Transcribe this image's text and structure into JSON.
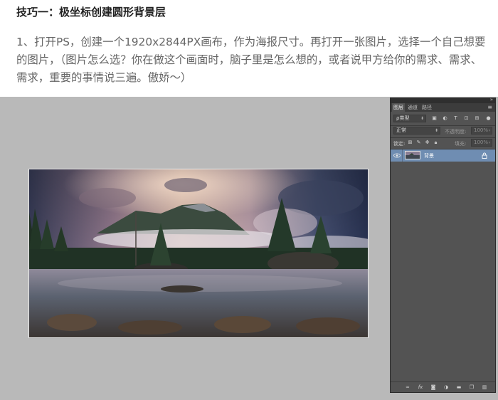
{
  "article": {
    "title": "技巧一：极坐标创建圆形背景层",
    "paragraph": "1、打开PS，创建一个1920x2844PX画布，作为海报尺寸。再打开一张图片，选择一个自己想要的图片，（图片怎么选？你在做这个画面时，脑子里是怎么想的，或者说甲方给你的需求、需求、需求，重要的事情说三遍。傲娇～）"
  },
  "layers_panel": {
    "collapse": "»",
    "tabs": [
      {
        "label": "图层",
        "active": true
      },
      {
        "label": "通道",
        "active": false
      },
      {
        "label": "路径",
        "active": false
      }
    ],
    "menu_icon": "≡",
    "filter": {
      "label": "ρ类型",
      "icons": [
        "image-filter-icon",
        "adjustment-filter-icon",
        "type-filter-icon",
        "shape-filter-icon",
        "smart-object-filter-icon",
        "toggle-filter-icon"
      ]
    },
    "blend_mode": "正常",
    "opacity": {
      "label": "不透明度:",
      "value": "100%"
    },
    "lock": {
      "label": "锁定:",
      "icons": [
        "lock-transparent-icon",
        "lock-image-icon",
        "lock-position-icon",
        "lock-all-icon"
      ]
    },
    "fill": {
      "label": "填充:",
      "value": "100%"
    },
    "layers": [
      {
        "name": "背景",
        "visible": true,
        "locked": true
      }
    ],
    "bottom_icons": [
      "link-layers-icon",
      "fx-icon",
      "add-mask-icon",
      "adjustment-layer-icon",
      "new-group-icon",
      "new-layer-icon",
      "delete-layer-icon"
    ]
  },
  "colors": {
    "workspace_bg": "#b9b9b9",
    "panel_bg": "#535353",
    "selected_layer": "#6f8db2"
  }
}
